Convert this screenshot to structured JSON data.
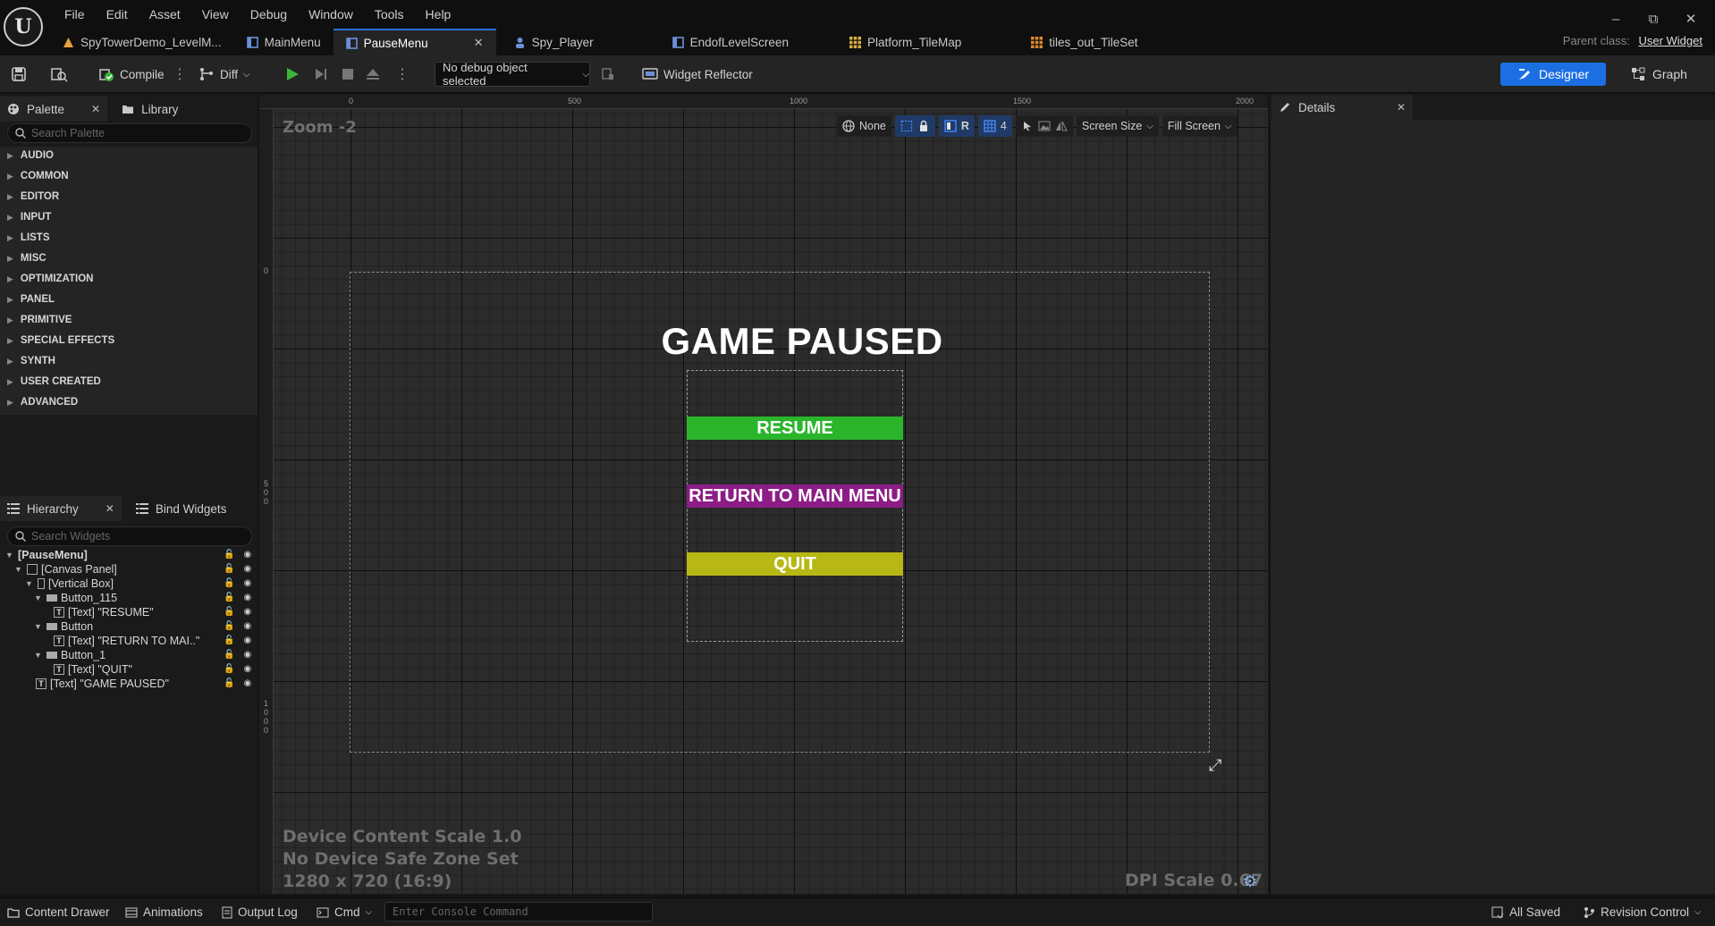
{
  "menu": [
    "File",
    "Edit",
    "Asset",
    "View",
    "Debug",
    "Window",
    "Tools",
    "Help"
  ],
  "tabs": [
    {
      "label": "SpyTowerDemo_LevelM...",
      "icon": "level-icon",
      "color": "#e8a33b"
    },
    {
      "label": "MainMenu",
      "icon": "widget-blueprint-icon",
      "color": "#6a8fd8"
    },
    {
      "label": "PauseMenu",
      "icon": "widget-blueprint-icon",
      "color": "#6a8fd8",
      "active": true
    },
    {
      "label": "Spy_Player",
      "icon": "character-icon",
      "color": "#6a8fd8"
    },
    {
      "label": "EndofLevelScreen",
      "icon": "widget-blueprint-icon",
      "color": "#6a8fd8"
    },
    {
      "label": "Platform_TileMap",
      "icon": "tilemap-icon",
      "color": "#d8b040"
    },
    {
      "label": "tiles_out_TileSet",
      "icon": "tileset-icon",
      "color": "#e08a30"
    }
  ],
  "parent_class": {
    "label": "Parent class:",
    "value": "User Widget"
  },
  "toolbar": {
    "compile": "Compile",
    "diff": "Diff",
    "debug_select": "No debug object selected",
    "widget_reflector": "Widget Reflector",
    "designer": "Designer",
    "graph": "Graph"
  },
  "palette": {
    "tab": "Palette",
    "library_tab": "Library",
    "search_placeholder": "Search Palette",
    "categories": [
      "AUDIO",
      "COMMON",
      "EDITOR",
      "INPUT",
      "LISTS",
      "MISC",
      "OPTIMIZATION",
      "PANEL",
      "PRIMITIVE",
      "SPECIAL EFFECTS",
      "SYNTH",
      "USER CREATED",
      "ADVANCED"
    ]
  },
  "hierarchy": {
    "tab": "Hierarchy",
    "bind_tab": "Bind Widgets",
    "search_placeholder": "Search Widgets",
    "nodes": [
      {
        "label": "[PauseMenu]",
        "depth": 0,
        "bold": true,
        "twist": "▼"
      },
      {
        "label": "[Canvas Panel]",
        "depth": 1,
        "twist": "▼",
        "icon": "canvas-icon"
      },
      {
        "label": "[Vertical Box]",
        "depth": 2,
        "twist": "▼",
        "icon": "vbox-icon"
      },
      {
        "label": "Button_115",
        "depth": 3,
        "twist": "▼",
        "icon": "button-icon"
      },
      {
        "label": "[Text] \"RESUME\"",
        "depth": 4,
        "icon": "text-icon"
      },
      {
        "label": "Button",
        "depth": 3,
        "twist": "▼",
        "icon": "button-icon"
      },
      {
        "label": "[Text] \"RETURN TO MAI..\"",
        "depth": 4,
        "icon": "text-icon"
      },
      {
        "label": "Button_1",
        "depth": 3,
        "twist": "▼",
        "icon": "button-icon"
      },
      {
        "label": "[Text] \"QUIT\"",
        "depth": 4,
        "icon": "text-icon"
      },
      {
        "label": "[Text] \"GAME PAUSED\"",
        "depth": 2,
        "icon": "text-icon"
      }
    ]
  },
  "viewport": {
    "zoom": "Zoom -2",
    "ruler_top": [
      "0",
      "500",
      "1000",
      "1500",
      "2000"
    ],
    "ruler_left": [
      "0",
      "500",
      "1000"
    ],
    "vp_none": "None",
    "vp_r": "R",
    "vp_grid": "4",
    "screen_size": "Screen Size",
    "fill_screen": "Fill Screen",
    "title": "GAME PAUSED",
    "buttons": [
      {
        "label": "RESUME",
        "color": "#2bb52b"
      },
      {
        "label": "RETURN TO MAIN MENU",
        "color": "#8c1d86"
      },
      {
        "label": "QUIT",
        "color": "#b8b814"
      }
    ],
    "device_content_scale": "Device Content Scale 1.0",
    "safe_zone": "No Device Safe Zone Set",
    "resolution": "1280 x 720 (16:9)",
    "dpi_scale": "DPI Scale 0.67"
  },
  "details": {
    "tab": "Details"
  },
  "statusbar": {
    "content_drawer": "Content Drawer",
    "animations": "Animations",
    "output_log": "Output Log",
    "cmd": "Cmd",
    "console_placeholder": "Enter Console Command",
    "all_saved": "All Saved",
    "revision_control": "Revision Control"
  }
}
